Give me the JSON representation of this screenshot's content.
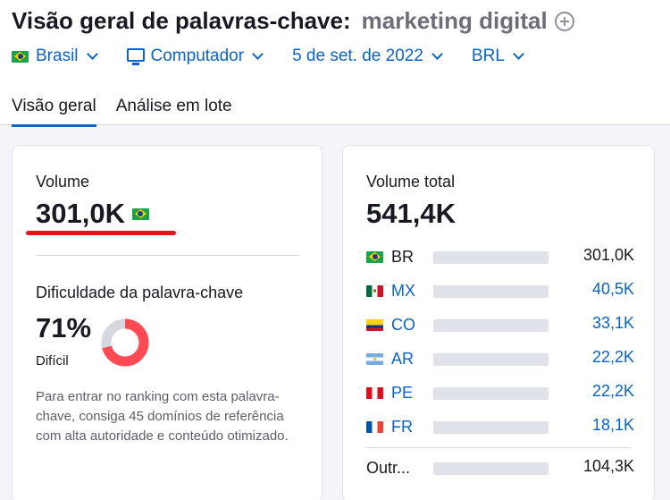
{
  "header": {
    "title": "Visão geral de palavras-chave:",
    "keyword": "marketing digital",
    "filters": {
      "country": "Brasil",
      "device": "Computador",
      "date": "5 de set. de 2022",
      "currency": "BRL"
    },
    "tabs": [
      "Visão geral",
      "Análise em lote"
    ]
  },
  "volume_card": {
    "label": "Volume",
    "value": "301,0K",
    "difficulty_label": "Dificuldade da palavra-chave",
    "difficulty_value": "71%",
    "difficulty_percent": 71,
    "difficulty_text": "Difícil",
    "difficulty_color": "#ff4953",
    "description": "Para entrar no ranking com esta palavra-chave, consiga 45 domínios de referência com alta autoridade e conteúdo otimizado."
  },
  "total_card": {
    "label": "Volume total",
    "value": "541,4K",
    "rows": [
      {
        "code": "BR",
        "value": "301,0K",
        "fill": 0.56,
        "flag": "br-flag-icon"
      },
      {
        "code": "MX",
        "value": "40,5K",
        "fill": 0.08,
        "flag": "mx-flag-icon"
      },
      {
        "code": "CO",
        "value": "33,1K",
        "fill": 0.06,
        "flag": "co-flag-icon"
      },
      {
        "code": "AR",
        "value": "22,2K",
        "fill": 0.04,
        "flag": "ar-flag-icon"
      },
      {
        "code": "PE",
        "value": "22,2K",
        "fill": 0.04,
        "flag": "pe-flag-icon"
      },
      {
        "code": "FR",
        "value": "18,1K",
        "fill": 0.04,
        "flag": "fr-flag-icon"
      },
      {
        "code": "Outr...",
        "value": "104,3K",
        "fill": 0.19
      }
    ]
  },
  "colors": {
    "accent": "#0a63c6",
    "bar_light": "#33b0f3",
    "underline": "#e3141c"
  }
}
